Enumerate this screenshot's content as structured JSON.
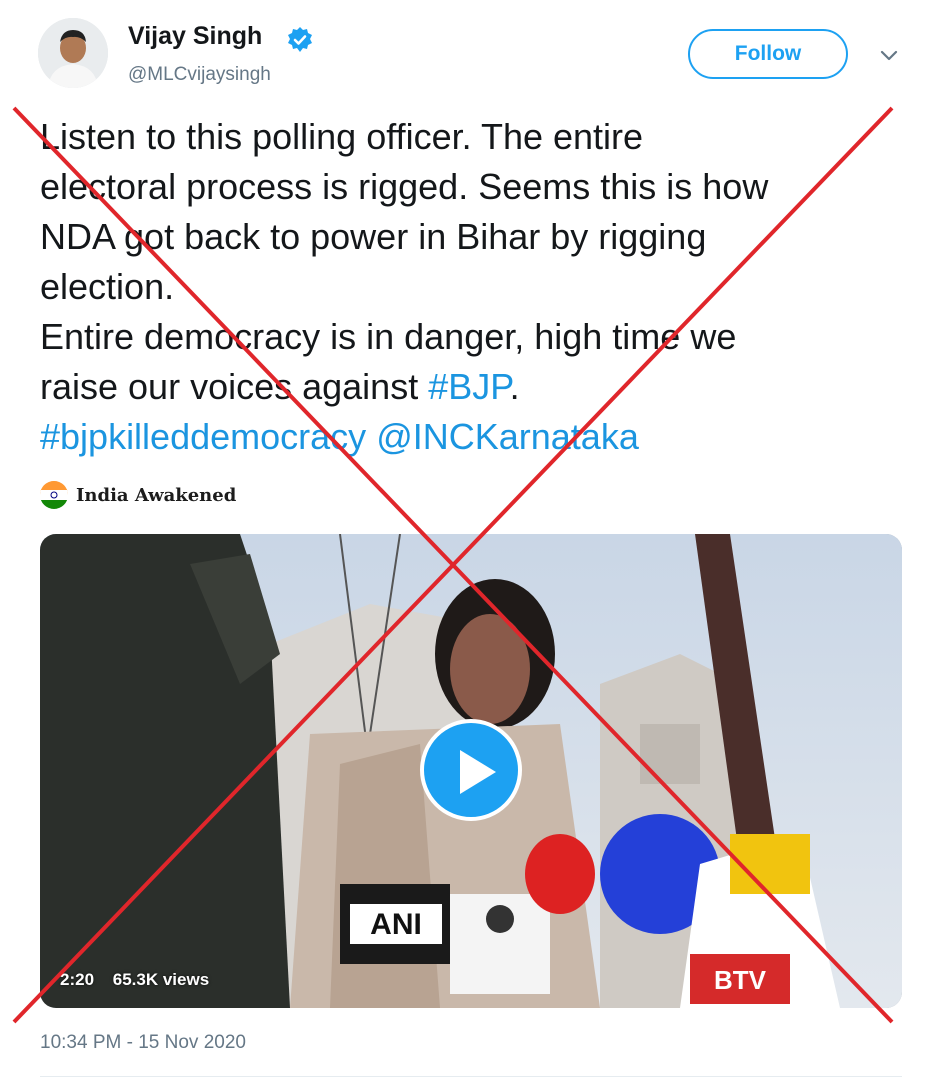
{
  "tweet": {
    "display_name": "Vijay Singh",
    "handle": "@MLCvijaysingh",
    "follow_label": "Follow",
    "text_lines": [
      "Listen to this polling officer. The entire",
      "electoral process is rigged. Seems this is how",
      "NDA got back to power in Bihar by rigging",
      "election.",
      "Entire democracy is in danger, high time we"
    ],
    "line6_prefix": "raise our voices against ",
    "hashtag_bjp": "#BJP",
    "line6_suffix": ".",
    "hashtag_killed": "#bjpkilleddemocracy",
    "mention": "@INCKarnataka",
    "timestamp": "10:34 PM - 15 Nov 2020"
  },
  "watermark": {
    "label": "India Awakened"
  },
  "video": {
    "duration": "2:20",
    "views": "65.3K views",
    "mic_labels": {
      "ani": "ANI",
      "news": "BTV"
    }
  },
  "colors": {
    "accent": "#1da1f2",
    "link": "#1b95e0",
    "secondary_text": "#657786",
    "cross_out": "#e0262b"
  },
  "icons": [
    "verified-badge-icon",
    "chevron-down-icon",
    "play-icon"
  ]
}
